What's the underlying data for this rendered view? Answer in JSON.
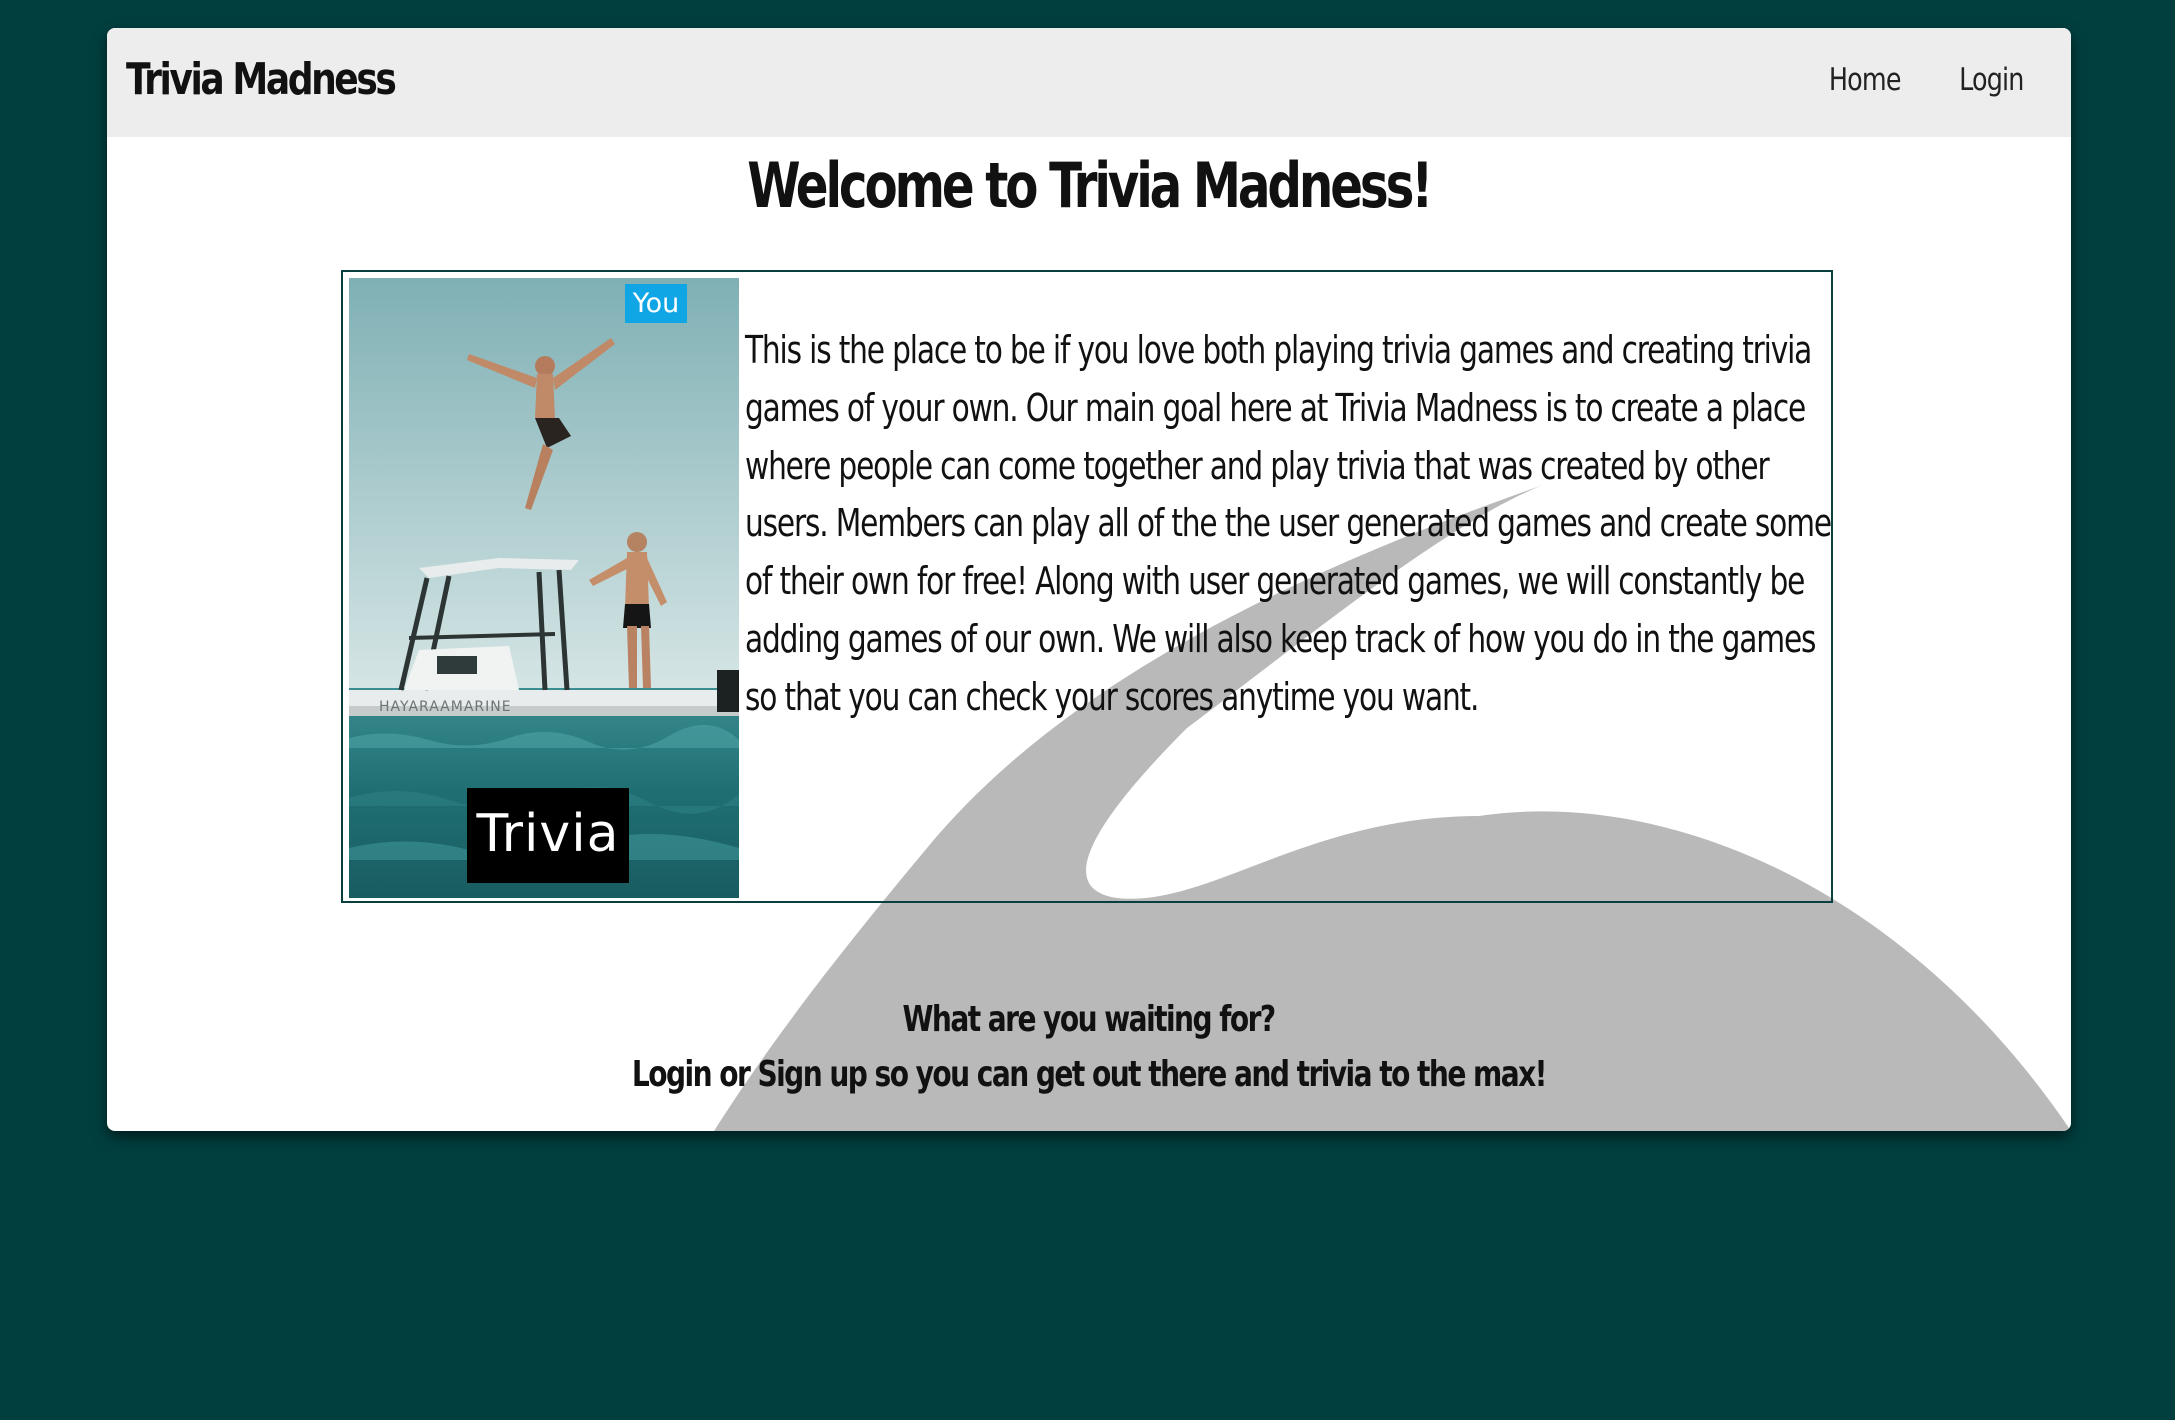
{
  "navbar": {
    "brand": "Trivia Madness",
    "links": [
      {
        "label": "Home"
      },
      {
        "label": "Login"
      }
    ]
  },
  "main": {
    "welcome_title": "Welcome to Trivia Madness!",
    "image": {
      "badge_text": "You",
      "caption_text": "Trivia"
    },
    "description": "This is the place to be if you love both playing trivia games and creating trivia games of your own. Our main goal here at Trivia Madness is to create a place where people can come together and play trivia that was created by other users. Members can play all of the the user generated games and create some of their own for free! Along with user generated games, we will constantly be adding games of our own. We will also keep track of how you do in the games so that you can check your scores anytime you want.",
    "cta_line1": "What are you waiting for?",
    "cta_line2": "Login or Sign up so you can get out there and trivia to the max!"
  },
  "colors": {
    "page_background": "#013f3f",
    "card_background": "#ffffff",
    "navbar_background": "#ededed",
    "swoosh": "#b9b9b9",
    "badge": "#10a6e6",
    "box_border": "#0a3f3f"
  },
  "icons": [
    "photo-image"
  ]
}
